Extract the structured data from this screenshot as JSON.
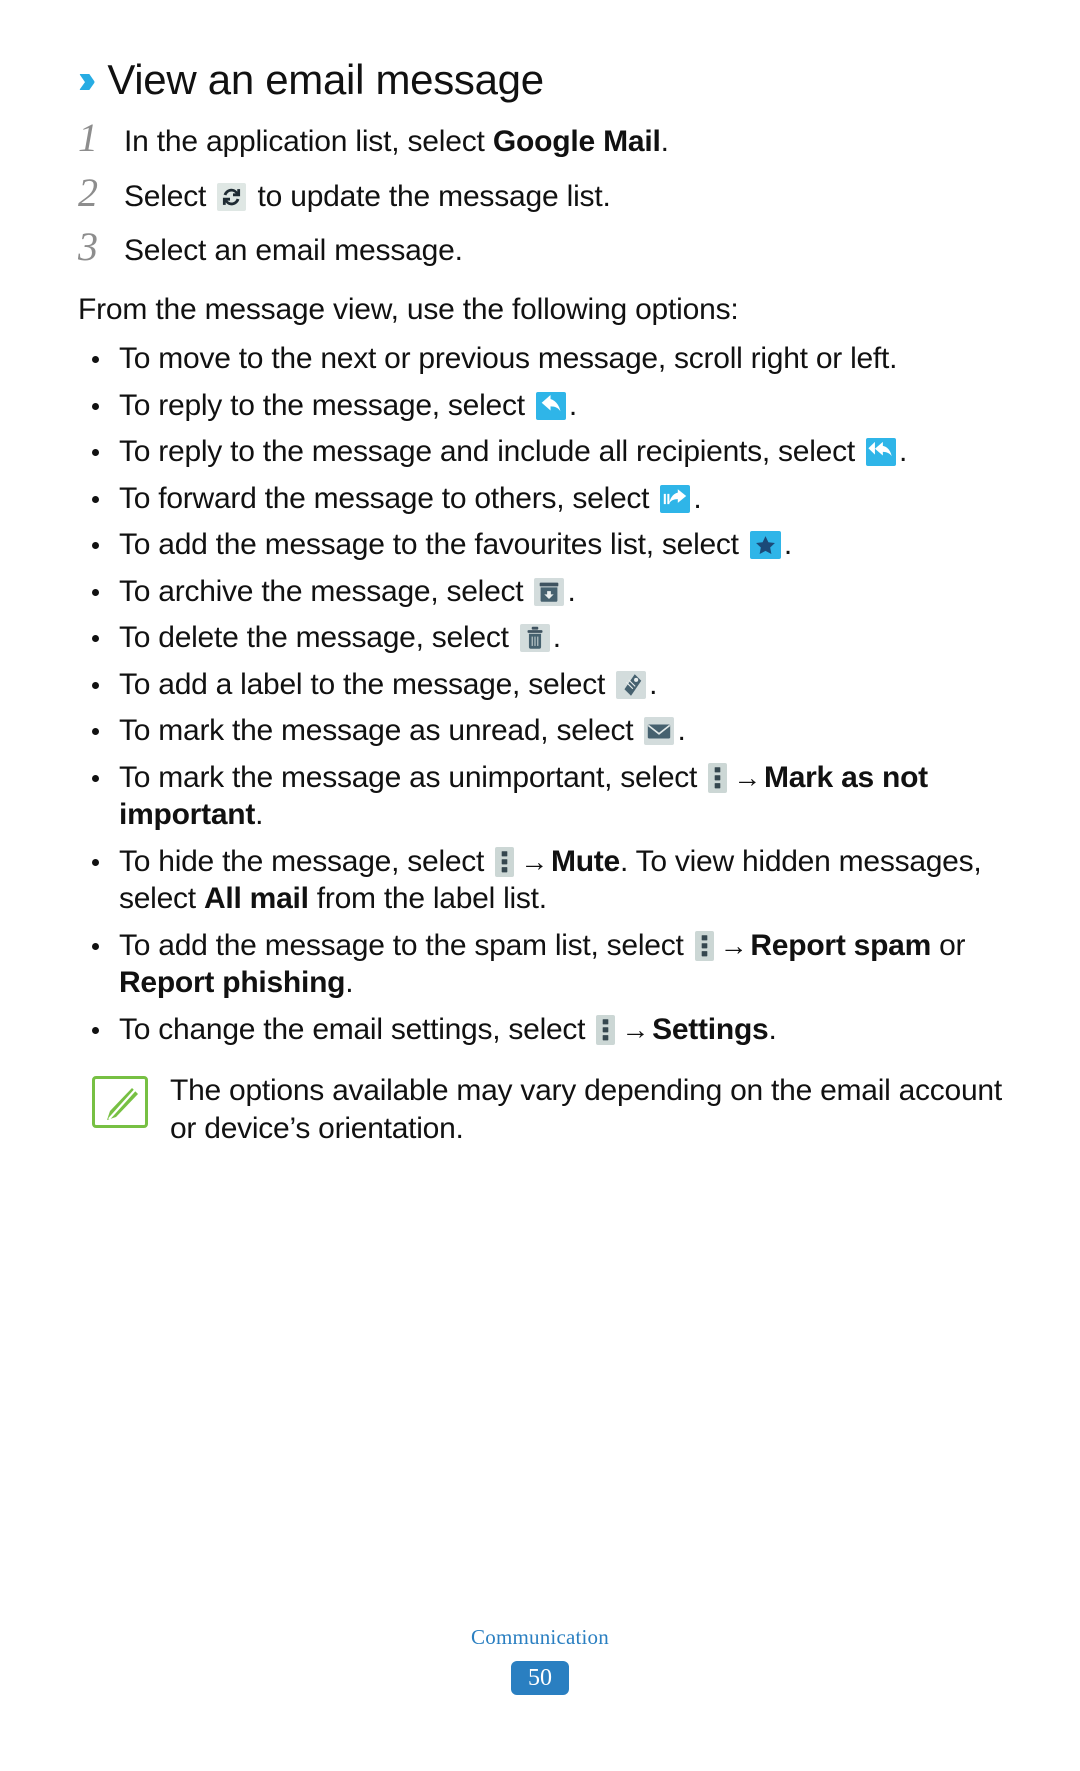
{
  "heading": {
    "chevron": "››",
    "title": "View an email message"
  },
  "steps": [
    {
      "num": "1",
      "pre": "In the application list, select ",
      "bold": "Google Mail",
      "post": "."
    },
    {
      "num": "2",
      "pre": "Select ",
      "icon": "refresh-icon",
      "post": " to update the message list."
    },
    {
      "num": "3",
      "pre": "Select an email message.",
      "post": ""
    }
  ],
  "intro": "From the message view, use the following options:",
  "options": [
    {
      "name": "option-scroll",
      "pre": "To move to the next or previous message, scroll right or left.",
      "icon": null,
      "post": ""
    },
    {
      "name": "option-reply",
      "pre": "To reply to the message, select ",
      "icon": "reply-icon",
      "post": "."
    },
    {
      "name": "option-reply-all",
      "pre": "To reply to the message and include all recipients, select ",
      "icon": "reply-all-icon",
      "post": "."
    },
    {
      "name": "option-forward",
      "pre": "To forward the message to others, select ",
      "icon": "forward-icon",
      "post": "."
    },
    {
      "name": "option-favourite",
      "pre": "To add the message to the favourites list, select ",
      "icon": "star-icon",
      "post": "."
    },
    {
      "name": "option-archive",
      "pre": "To archive the message, select ",
      "icon": "archive-icon",
      "post": "."
    },
    {
      "name": "option-delete",
      "pre": "To delete the message, select ",
      "icon": "trash-icon",
      "post": "."
    },
    {
      "name": "option-label",
      "pre": "To add a label to the message, select ",
      "icon": "label-icon",
      "post": "."
    },
    {
      "name": "option-unread",
      "pre": "To mark the message as unread, select ",
      "icon": "envelope-icon",
      "post": "."
    },
    {
      "name": "option-unimportant",
      "pre": "To mark the message as unimportant, select ",
      "icon": "menu-icon",
      "arrow": "→",
      "bold": "Mark as not important",
      "post": "."
    },
    {
      "name": "option-mute",
      "pre": "To hide the message, select ",
      "icon": "menu-icon",
      "arrow": "→",
      "bold": "Mute",
      "post": ". To view hidden messages, select ",
      "bold2": "All mail",
      "post2": " from the label list."
    },
    {
      "name": "option-spam",
      "pre": "To add the message to the spam list, select ",
      "icon": "menu-icon",
      "arrow": "→",
      "bold": "Report spam",
      "post": " or ",
      "bold2": "Report phishing",
      "post2": "."
    },
    {
      "name": "option-settings",
      "pre": "To change the email settings, select ",
      "icon": "menu-icon",
      "arrow": "→",
      "bold": "Settings",
      "post": "."
    }
  ],
  "note": {
    "icon": "note-pen-icon",
    "text": "The options available may vary depending on the email account or device’s orientation."
  },
  "footer": {
    "section": "Communication",
    "page_number": "50"
  },
  "colors": {
    "accent_blue": "#2fb5e8",
    "heading_chevron": "#27ace3",
    "footer_blue": "#2a7fc1",
    "note_green": "#77c043",
    "icon_gray": "#d3dcdc",
    "step_number_gray": "#8d8d8d"
  }
}
